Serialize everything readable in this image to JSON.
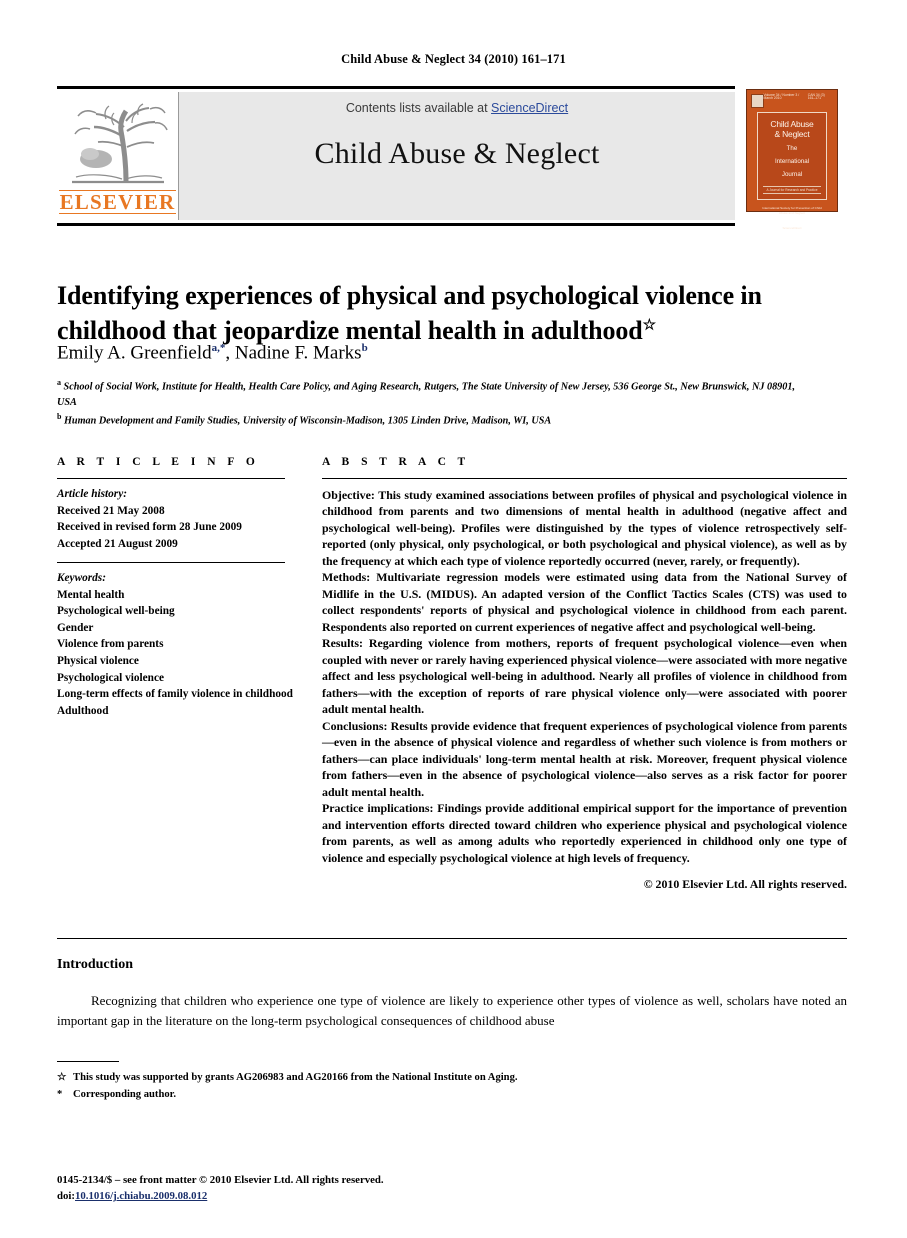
{
  "running_head": "Child Abuse & Neglect 34 (2010) 161–171",
  "masthead": {
    "contents_prefix": "Contents lists available at ",
    "sciencedirect": "ScienceDirect",
    "journal_title": "Child Abuse & Neglect",
    "publisher_wordmark": "ELSEVIER",
    "publisher_accent_color": "#E87722",
    "band_color": "#e8e8e8",
    "link_color": "#2b4a9b"
  },
  "cover": {
    "top_left_label": "ISSN 0145-2134",
    "top_center_label": "Volume 34 / Number 3 / March 2010",
    "top_right_label": "CAN 34 (3) 161–171",
    "line1": "Child Abuse",
    "line2": "& Neglect",
    "line3": "The",
    "line4": "International",
    "line5": "Journal",
    "tagline": "A Journal for Research and Practice",
    "foot1": "ISPCAN",
    "foot2": "International Society for Prevention of Child Abuse and Neglect",
    "foot3": "Available online at",
    "foot4": "ScienceDirect",
    "background_color": "#c8541d"
  },
  "article": {
    "title": "Identifying experiences of physical and psychological violence in childhood that jeopardize mental health in adulthood",
    "title_footnote_marker": "☆",
    "authors_1": "Emily A. Greenfield",
    "authors_1_marks": "a,*",
    "authors_sep": ", ",
    "authors_2": "Nadine F. Marks",
    "authors_2_marks": "b",
    "affiliation_a_marker": "a",
    "affiliation_a": "School of Social Work, Institute for Health, Health Care Policy, and Aging Research, Rutgers, The State University of New Jersey, 536 George St., New Brunswick, NJ 08901, USA",
    "affiliation_b_marker": "b",
    "affiliation_b": "Human Development and Family Studies, University of Wisconsin-Madison, 1305 Linden Drive, Madison, WI, USA"
  },
  "article_info": {
    "heading": "A R T I C L E   I N F O",
    "history_label": "Article history:",
    "received": "Received 21 May 2008",
    "revised": "Received in revised form 28 June 2009",
    "accepted": "Accepted 21 August 2009",
    "keywords_label": "Keywords:",
    "keywords": [
      "Mental health",
      "Psychological well-being",
      "Gender",
      "Violence from parents",
      "Physical violence",
      "Psychological violence",
      "Long-term effects of family violence in childhood",
      "Adulthood"
    ]
  },
  "abstract": {
    "heading": "A B S T R A C T",
    "sections": [
      {
        "label": "Objective:",
        "text": " This study examined associations between profiles of physical and psychological violence in childhood from parents and two dimensions of mental health in adulthood (negative affect and psychological well-being). Profiles were distinguished by the types of violence retrospectively self-reported (only physical, only psychological, or both psychological and physical violence), as well as by the frequency at which each type of violence reportedly occurred (never, rarely, or frequently)."
      },
      {
        "label": "Methods:",
        "text": " Multivariate regression models were estimated using data from the National Survey of Midlife in the U.S. (MIDUS). An adapted version of the Conflict Tactics Scales (CTS) was used to collect respondents' reports of physical and psychological violence in childhood from each parent. Respondents also reported on current experiences of negative affect and psychological well-being."
      },
      {
        "label": "Results:",
        "text": " Regarding violence from mothers, reports of frequent psychological violence—even when coupled with never or rarely having experienced physical violence—were associated with more negative affect and less psychological well-being in adulthood. Nearly all profiles of violence in childhood from fathers—with the exception of reports of rare physical violence only—were associated with poorer adult mental health."
      },
      {
        "label": "Conclusions:",
        "text": " Results provide evidence that frequent experiences of psychological violence from parents—even in the absence of physical violence and regardless of whether such violence is from mothers or fathers—can place individuals' long-term mental health at risk. Moreover, frequent physical violence from fathers—even in the absence of psychological violence—also serves as a risk factor for poorer adult mental health."
      },
      {
        "label": "Practice implications:",
        "text": " Findings provide additional empirical support for the importance of prevention and intervention efforts directed toward children who experience physical and psychological violence from parents, as well as among adults who reportedly experienced in childhood only one type of violence and especially psychological violence at high levels of frequency."
      }
    ],
    "copyright": "© 2010 Elsevier Ltd. All rights reserved."
  },
  "introduction": {
    "heading": "Introduction",
    "paragraph": "Recognizing that children who experience one type of violence are likely to experience other types of violence as well, scholars have noted an important gap in the literature on the long-term psychological consequences of childhood abuse"
  },
  "footnotes": [
    {
      "marker": "☆",
      "text": "This study was supported by grants AG206983 and AG20166 from the National Institute on Aging."
    },
    {
      "marker": "*",
      "text": "Corresponding author."
    }
  ],
  "colophon": {
    "issn_line": "0145-2134/$ – see front matter © 2010 Elsevier Ltd. All rights reserved.",
    "doi_prefix": "doi:",
    "doi": "10.1016/j.chiabu.2009.08.012",
    "doi_color": "#1a2f6b"
  }
}
